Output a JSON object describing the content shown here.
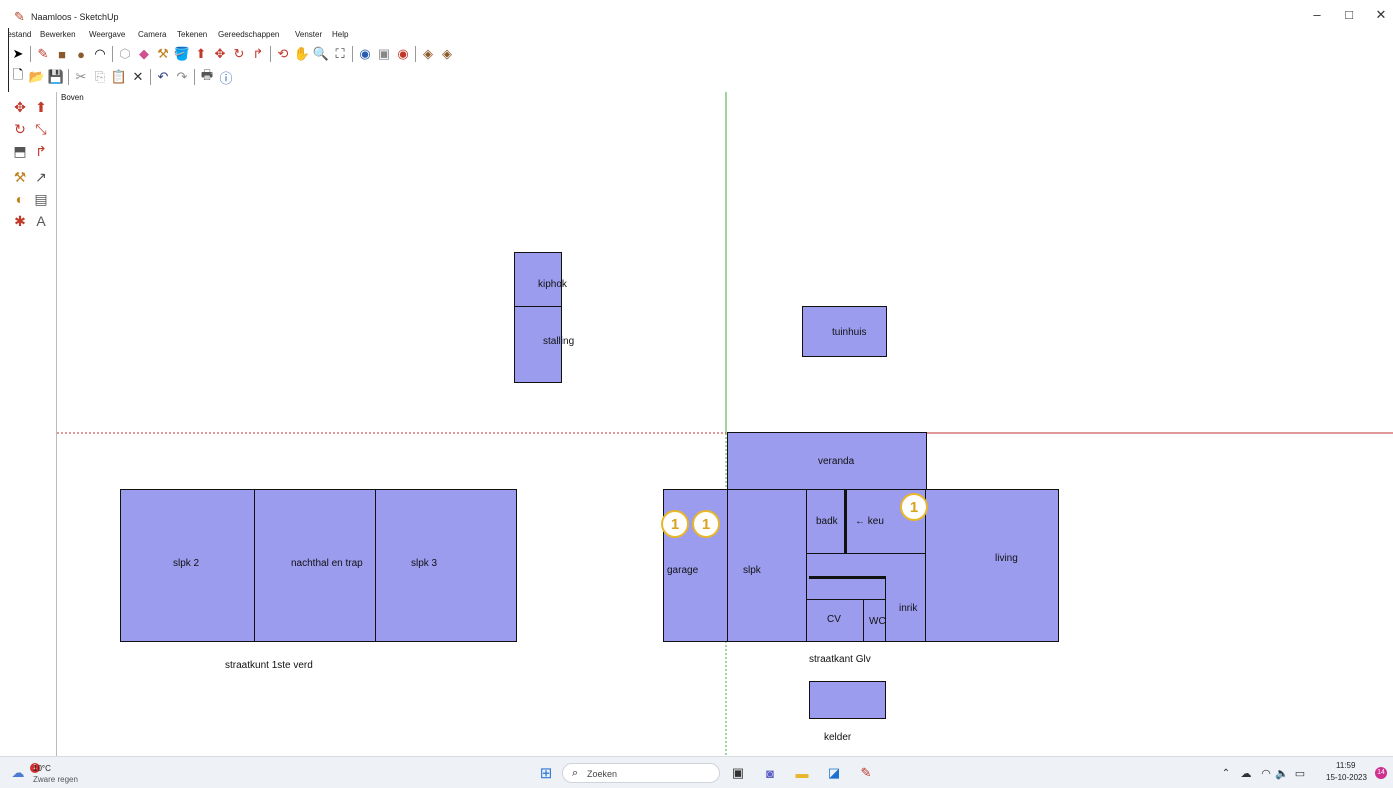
{
  "window": {
    "title": "Naamloos - SketchUp",
    "minimize": "–",
    "maximize": "□",
    "close": "✕"
  },
  "menu": [
    "Bestand",
    "Bewerken",
    "Weergave",
    "Camera",
    "Tekenen",
    "Gereedschappen",
    "Venster",
    "Help"
  ],
  "toolbar1_icons": [
    "select-icon",
    "line-icon",
    "rectangle-icon",
    "circle-icon",
    "arc-icon",
    "eraser-icon",
    "paint-icon",
    "tape-icon",
    "protractor-icon",
    "pushpull-icon",
    "move-icon",
    "rotate-icon",
    "followme-icon",
    "orbit-icon",
    "pan-icon",
    "zoom-icon",
    "zoom-extents-icon",
    "previous-view-icon",
    "next-view-icon",
    "warehouse-icon",
    "components-icon",
    "extension-icon"
  ],
  "toolbar2_icons": [
    "new-icon",
    "open-icon",
    "save-icon",
    "cut-icon",
    "copy-icon",
    "paste-icon",
    "delete-icon",
    "undo-icon",
    "redo-icon",
    "print-icon",
    "model-info-icon"
  ],
  "view_label": "Boven",
  "rooms": {
    "kiphok": "kiphok",
    "stalling": "stalling",
    "tuinhuis": "tuinhuis",
    "veranda": "veranda",
    "slpk2": "slpk 2",
    "nachthal": "nachthal en trap",
    "slpk3": "slpk 3",
    "garage": "garage",
    "slpk": "slpk",
    "badk": "badk",
    "keuken": "← keu",
    "living": "living",
    "inkom": "inrik",
    "cv": "CV",
    "wc": "WC",
    "kelder_room": ""
  },
  "labels": {
    "first_floor": "straatkunt 1ste verd",
    "ground_floor": "straatkant Glv",
    "kelder": "kelder"
  },
  "badges": [
    "1",
    "1",
    "1"
  ],
  "taskbar": {
    "weather_temp": "10°C",
    "weather_desc": "Zware regen",
    "weather_badge": "1",
    "search_placeholder": "Zoeken",
    "time": "11:59",
    "date": "15-10-2023",
    "notif_count": "14"
  },
  "colors": {
    "room_fill": "#9b9cee",
    "axis_green": "#3daa3d",
    "axis_red": "#c03030",
    "badge": "#e8b62a"
  }
}
